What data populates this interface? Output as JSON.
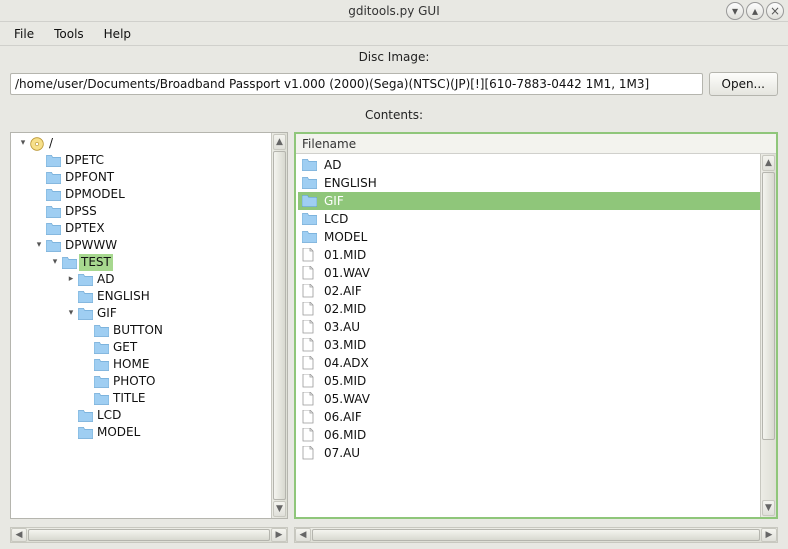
{
  "window": {
    "title": "gditools.py GUI",
    "buttons": {
      "min": "v",
      "max": "^",
      "close": "x"
    }
  },
  "menubar": [
    {
      "label": "File"
    },
    {
      "label": "Tools"
    },
    {
      "label": "Help"
    }
  ],
  "disc_section": {
    "label": "Disc Image:",
    "path": "/home/user/Documents/Broadband Passport v1.000 (2000)(Sega)(NTSC)(JP)[!][610-7883-0442 1M1, 1M3]",
    "open_label": "Open..."
  },
  "contents_label": "Contents:",
  "tree": [
    {
      "depth": 0,
      "type": "disc",
      "exp": "v",
      "label": "/"
    },
    {
      "depth": 1,
      "type": "folder",
      "exp": "",
      "label": "DPETC"
    },
    {
      "depth": 1,
      "type": "folder",
      "exp": "",
      "label": "DPFONT"
    },
    {
      "depth": 1,
      "type": "folder",
      "exp": "",
      "label": "DPMODEL"
    },
    {
      "depth": 1,
      "type": "folder",
      "exp": "",
      "label": "DPSS"
    },
    {
      "depth": 1,
      "type": "folder",
      "exp": "",
      "label": "DPTEX"
    },
    {
      "depth": 1,
      "type": "folder",
      "exp": "v",
      "label": "DPWWW"
    },
    {
      "depth": 2,
      "type": "folder",
      "exp": "v",
      "label": "TEST",
      "selected": true
    },
    {
      "depth": 3,
      "type": "folder",
      "exp": ">",
      "label": "AD"
    },
    {
      "depth": 3,
      "type": "folder",
      "exp": "",
      "label": "ENGLISH"
    },
    {
      "depth": 3,
      "type": "folder",
      "exp": "v",
      "label": "GIF"
    },
    {
      "depth": 4,
      "type": "folder",
      "exp": "",
      "label": "BUTTON"
    },
    {
      "depth": 4,
      "type": "folder",
      "exp": "",
      "label": "GET"
    },
    {
      "depth": 4,
      "type": "folder",
      "exp": "",
      "label": "HOME"
    },
    {
      "depth": 4,
      "type": "folder",
      "exp": "",
      "label": "PHOTO"
    },
    {
      "depth": 4,
      "type": "folder",
      "exp": "",
      "label": "TITLE"
    },
    {
      "depth": 3,
      "type": "folder",
      "exp": "",
      "label": "LCD"
    },
    {
      "depth": 3,
      "type": "folder",
      "exp": "",
      "label": "MODEL"
    }
  ],
  "list": {
    "header": "Filename",
    "items": [
      {
        "type": "folder",
        "label": "AD"
      },
      {
        "type": "folder",
        "label": "ENGLISH"
      },
      {
        "type": "folder",
        "label": "GIF",
        "selected": true
      },
      {
        "type": "folder",
        "label": "LCD"
      },
      {
        "type": "folder",
        "label": "MODEL"
      },
      {
        "type": "file",
        "label": "01.MID"
      },
      {
        "type": "file",
        "label": "01.WAV"
      },
      {
        "type": "file",
        "label": "02.AIF"
      },
      {
        "type": "file",
        "label": "02.MID"
      },
      {
        "type": "file",
        "label": "03.AU"
      },
      {
        "type": "file",
        "label": "03.MID"
      },
      {
        "type": "file",
        "label": "04.ADX"
      },
      {
        "type": "file",
        "label": "05.MID"
      },
      {
        "type": "file",
        "label": "05.WAV"
      },
      {
        "type": "file",
        "label": "06.AIF"
      },
      {
        "type": "file",
        "label": "06.MID"
      },
      {
        "type": "file",
        "label": "07.AU"
      }
    ]
  }
}
